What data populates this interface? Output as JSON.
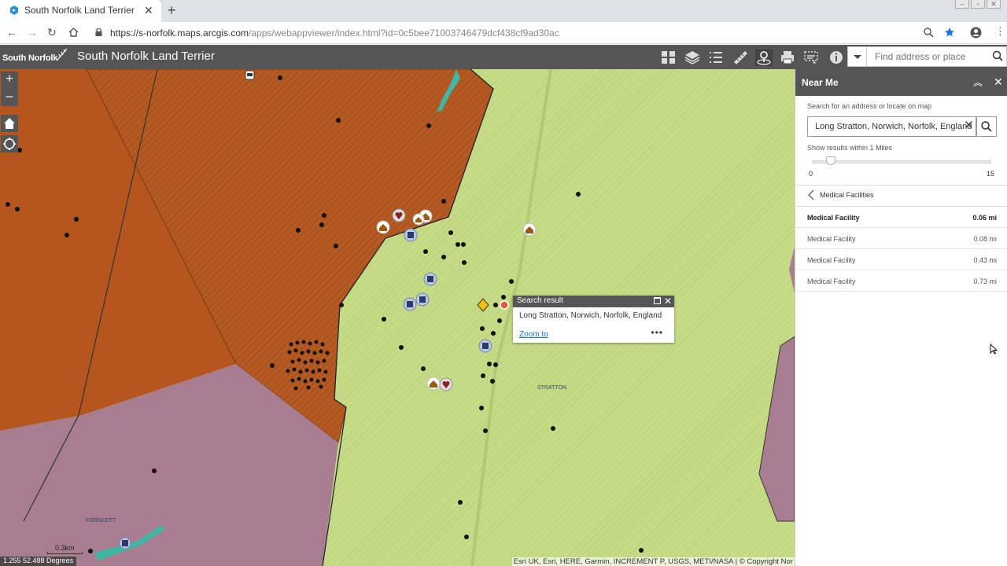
{
  "browser": {
    "tab_title": "South Norfolk Land Terrier",
    "url_host": "https://s-norfolk.maps.arcgis.com",
    "url_path": "/apps/webappviewer/index.html?id=0c5bee71003746479dcf438cf9ad30ac"
  },
  "app": {
    "logo_text": "South Norfolk",
    "title": "South Norfolk Land Terrier",
    "search_placeholder": "Find address or place"
  },
  "toolbar_icons": [
    "overview-grid-icon",
    "layers-icon",
    "legend-list-icon",
    "measure-ruler-icon",
    "near-me-icon",
    "print-icon",
    "select-icon",
    "info-icon"
  ],
  "map": {
    "popup": {
      "title": "Search result",
      "address": "Long Stratton, Norwich, Norfolk, England",
      "zoom_link": "Zoom to",
      "more": "•••"
    },
    "labels": {
      "stratton": "STRATTON",
      "forncett": "FORNCETT"
    },
    "scale_text": "0.3km",
    "coordinates": "1.255 52.488 Degrees",
    "attribution": "Esri UK, Esri, HERE, Garmin, INCREMENT P, USGS, METI/NASA | © Copyright Nor"
  },
  "panel": {
    "title": "Near Me",
    "search_label": "Search for an address or locate on map",
    "address_value": "Long Stratton, Norwich, Norfolk, England",
    "radius_label": "Show results within 1 Miles",
    "radius_value": 1,
    "slider_min": "0",
    "slider_max": "15",
    "category": "Medical Facilities",
    "results": [
      {
        "name": "Medical Facility",
        "distance": "0.06 mi"
      },
      {
        "name": "Medical Facility",
        "distance": "0.08 mi"
      },
      {
        "name": "Medical Facility",
        "distance": "0.43 mi"
      },
      {
        "name": "Medical Facility",
        "distance": "0.73 mi"
      }
    ]
  },
  "colors": {
    "header": "#555555",
    "orange_area": "#b5561f",
    "green_area": "#c3d882",
    "purple_area": "#a67b8f",
    "link": "#1a73c9"
  }
}
